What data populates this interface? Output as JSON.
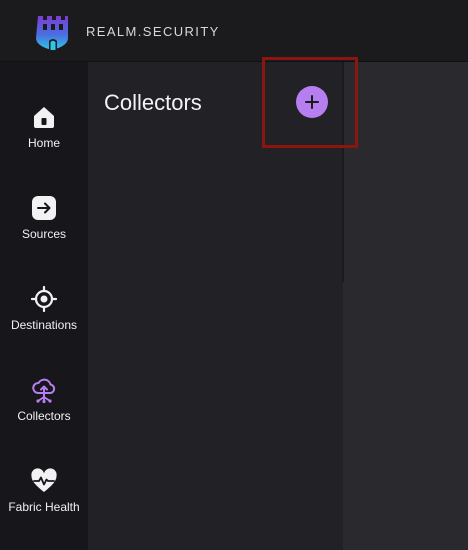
{
  "app": {
    "brand": "REALM.SECURITY",
    "accent_color": "#b77ef1",
    "logo_icon": "castle-tower-logo"
  },
  "sidebar": {
    "items": [
      {
        "label": "Home",
        "icon": "home-icon",
        "active": false
      },
      {
        "label": "Sources",
        "icon": "arrow-right-square-icon",
        "active": false
      },
      {
        "label": "Destinations",
        "icon": "crosshair-icon",
        "active": false
      },
      {
        "label": "Collectors",
        "icon": "cloud-upload-network-icon",
        "active": true
      },
      {
        "label": "Fabric Health",
        "icon": "heart-pulse-icon",
        "active": false
      }
    ]
  },
  "panel": {
    "title": "Collectors",
    "add_button_icon": "plus-icon"
  }
}
